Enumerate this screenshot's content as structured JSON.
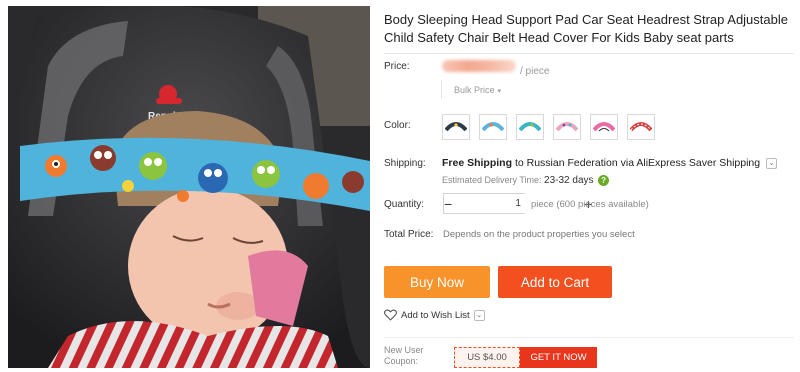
{
  "product": {
    "title": "Body Sleeping Head Support Pad Car Seat Headrest Strap Adjustable Child Safety Chair Belt Head Cover For Kids Baby seat parts",
    "image_brand_text": "Renolux"
  },
  "price": {
    "label": "Price:",
    "unit": "/ piece",
    "bulk_label": "Bulk Price",
    "bulk_caret": "▾"
  },
  "color": {
    "label": "Color:",
    "swatches": [
      {
        "name": "dark-owls",
        "color": "#2d3a4a"
      },
      {
        "name": "blue-owls",
        "color": "#5fb4df"
      },
      {
        "name": "teal-owls",
        "color": "#3cb4c4"
      },
      {
        "name": "pink-dots",
        "color": "#e8a6c0"
      },
      {
        "name": "pink-strap",
        "color": "#e96aa6"
      },
      {
        "name": "red-white",
        "color": "#d94141"
      }
    ]
  },
  "shipping": {
    "label": "Shipping:",
    "free_text": "Free Shipping",
    "to_text": "to",
    "destination": "Russian Federation",
    "via_text": "via AliExpress Saver Shipping",
    "chevron": "⌄",
    "delivery_label": "Estimated Delivery Time:",
    "delivery_days": "23-32 days",
    "help": "?"
  },
  "quantity": {
    "label": "Quantity:",
    "minus": "−",
    "value": "1",
    "plus": "+",
    "available": "piece (600 pieces available)"
  },
  "total": {
    "label": "Total Price:",
    "text": "Depends on the product properties you select"
  },
  "actions": {
    "buy_now": "Buy Now",
    "add_to_cart": "Add to Cart",
    "wishlist": "Add to Wish List",
    "wishlist_chevron": "⌄"
  },
  "coupon": {
    "label": "New User Coupon:",
    "amount": "US $4.00",
    "cta": "GET IT NOW"
  },
  "colors": {
    "buy_now_bg": "#f8922b",
    "add_to_cart_bg": "#f2501f",
    "coupon_bg": "#e8351c",
    "delivery_help": "#6aab28"
  }
}
